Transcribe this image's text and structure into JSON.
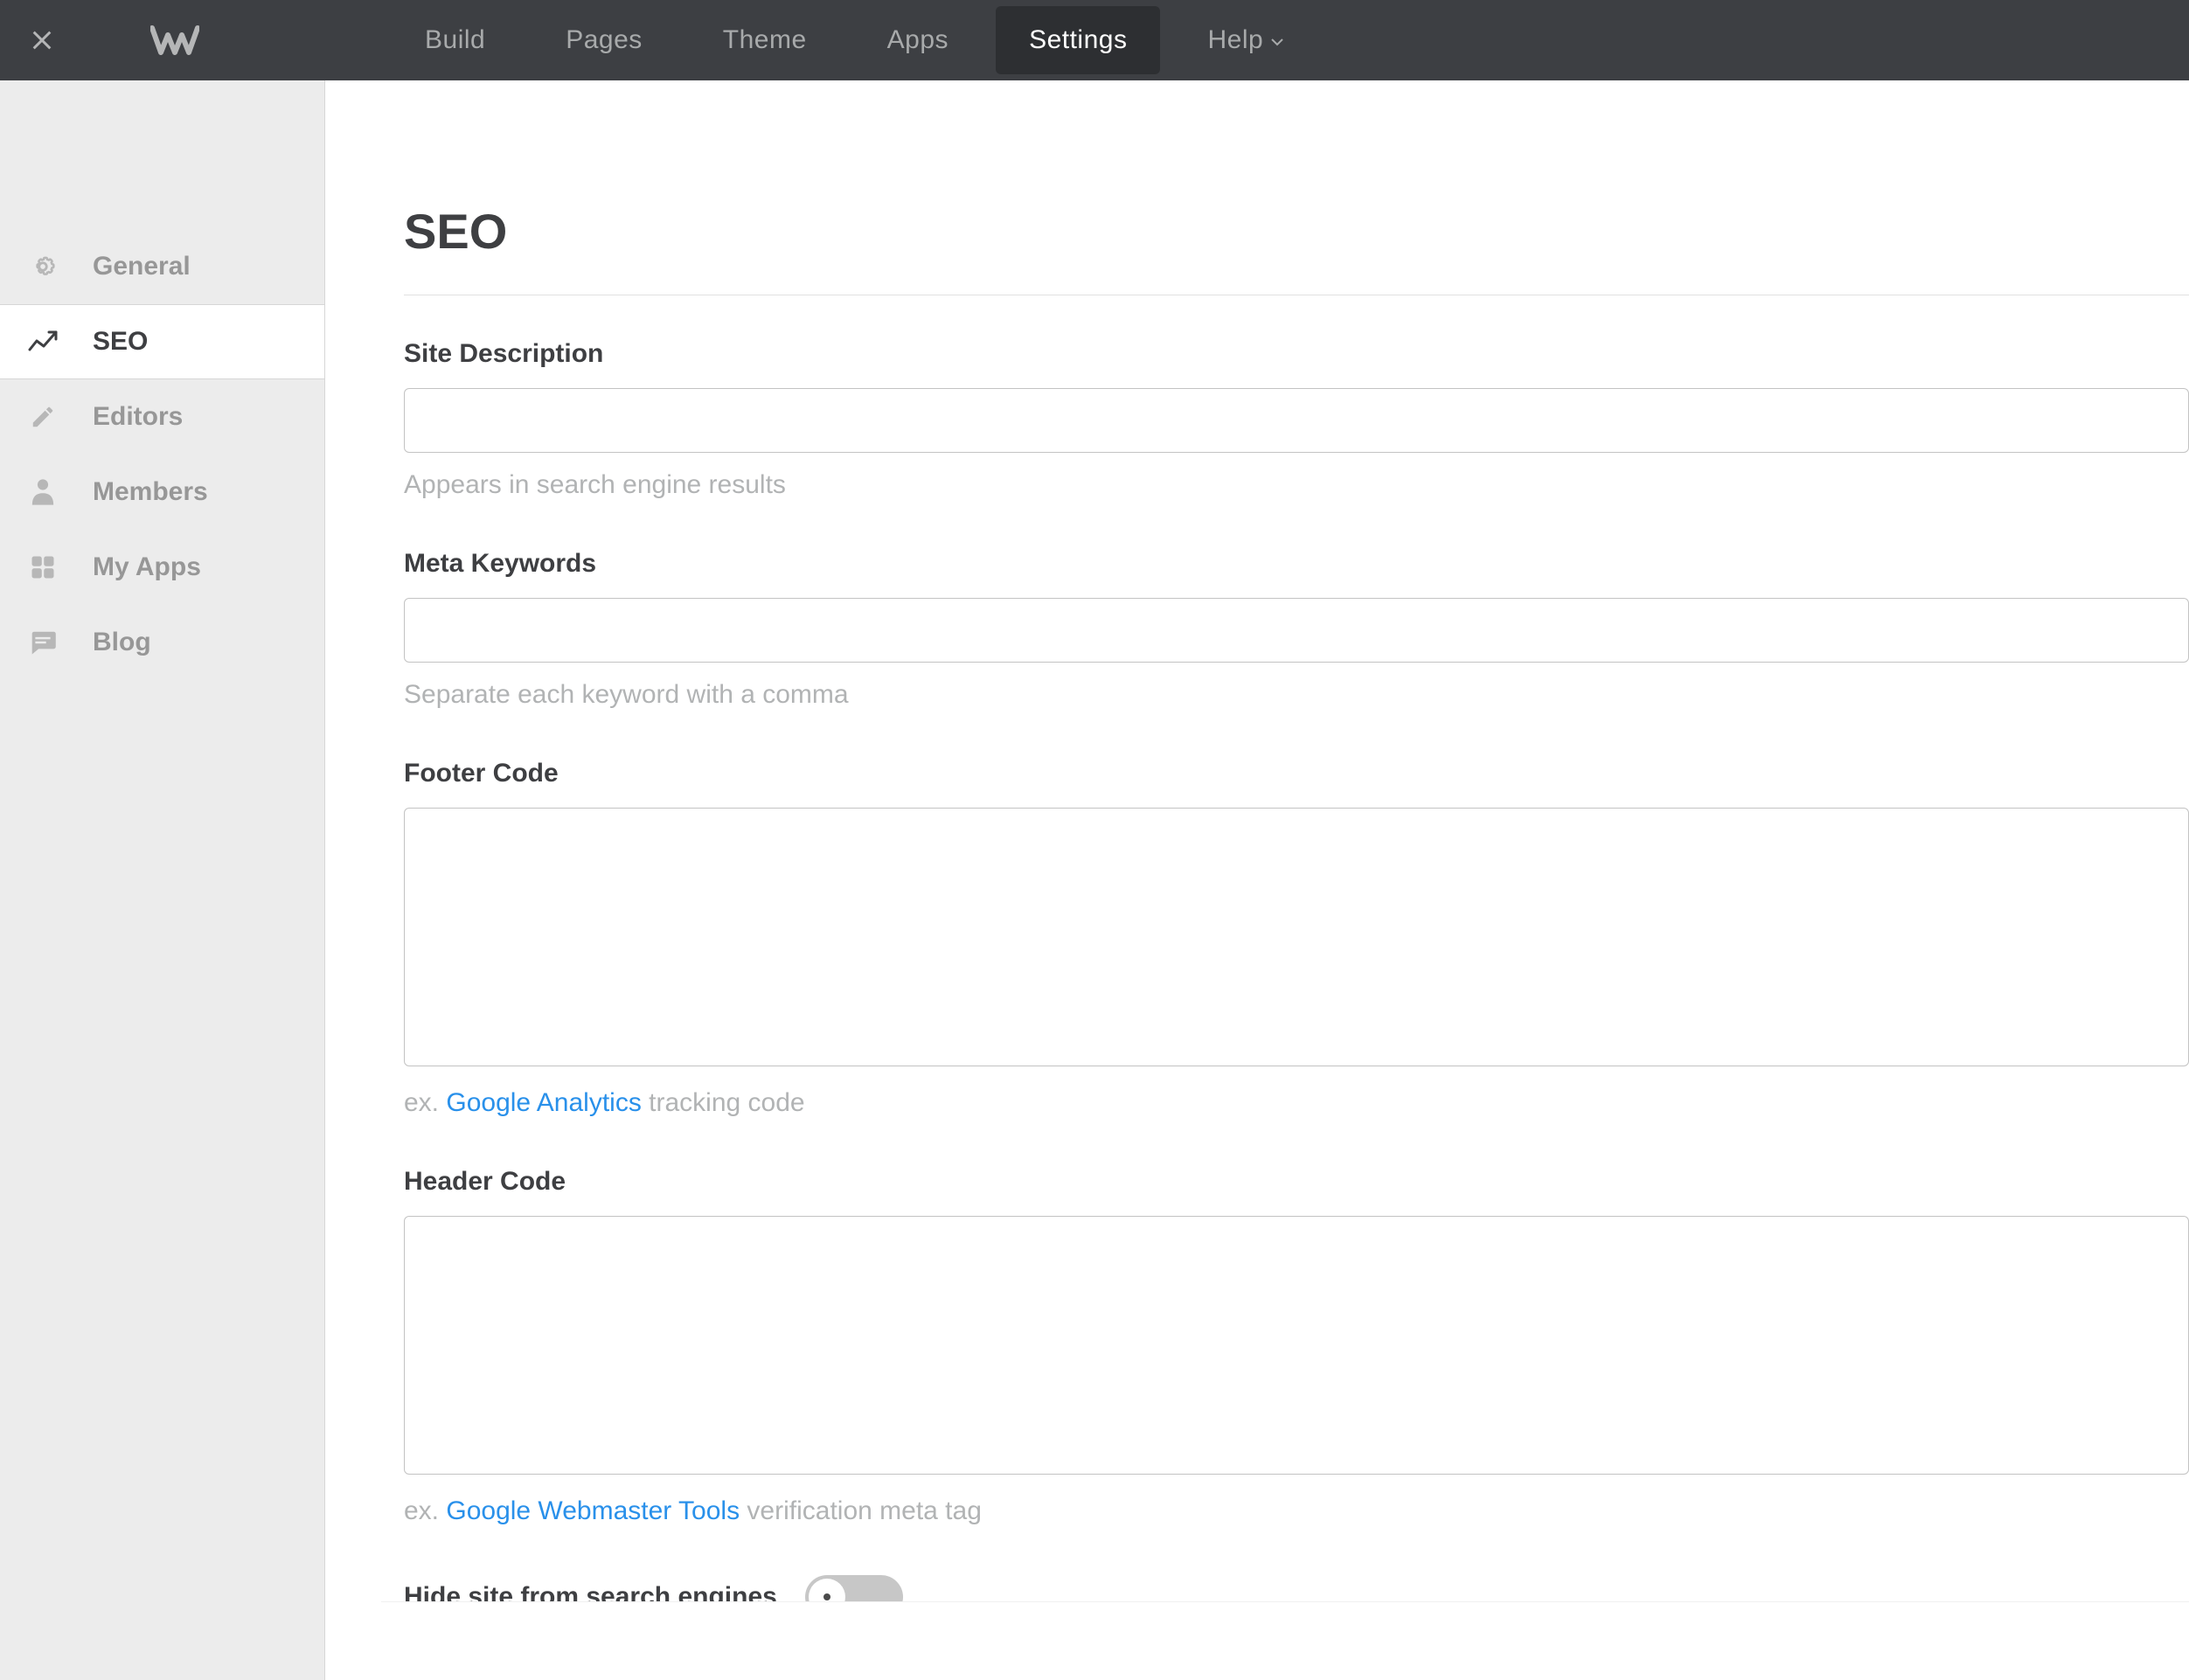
{
  "topbar": {
    "nav": {
      "build": "Build",
      "pages": "Pages",
      "theme": "Theme",
      "apps": "Apps",
      "settings": "Settings",
      "help": "Help"
    }
  },
  "sidebar": {
    "general": "General",
    "seo": "SEO",
    "editors": "Editors",
    "members": "Members",
    "myapps": "My Apps",
    "blog": "Blog"
  },
  "page": {
    "title": "SEO",
    "site_description": {
      "label": "Site Description",
      "value": "",
      "hint": "Appears in search engine results"
    },
    "meta_keywords": {
      "label": "Meta Keywords",
      "value": "",
      "hint": "Separate each keyword with a comma"
    },
    "footer_code": {
      "label": "Footer Code",
      "value": "",
      "hint_prefix": "ex. ",
      "hint_link": "Google Analytics",
      "hint_suffix": " tracking code"
    },
    "header_code": {
      "label": "Header Code",
      "value": "",
      "hint_prefix": "ex. ",
      "hint_link": "Google Webmaster Tools",
      "hint_suffix": " verification meta tag"
    },
    "hide_site": {
      "label": "Hide site from search engines"
    }
  }
}
